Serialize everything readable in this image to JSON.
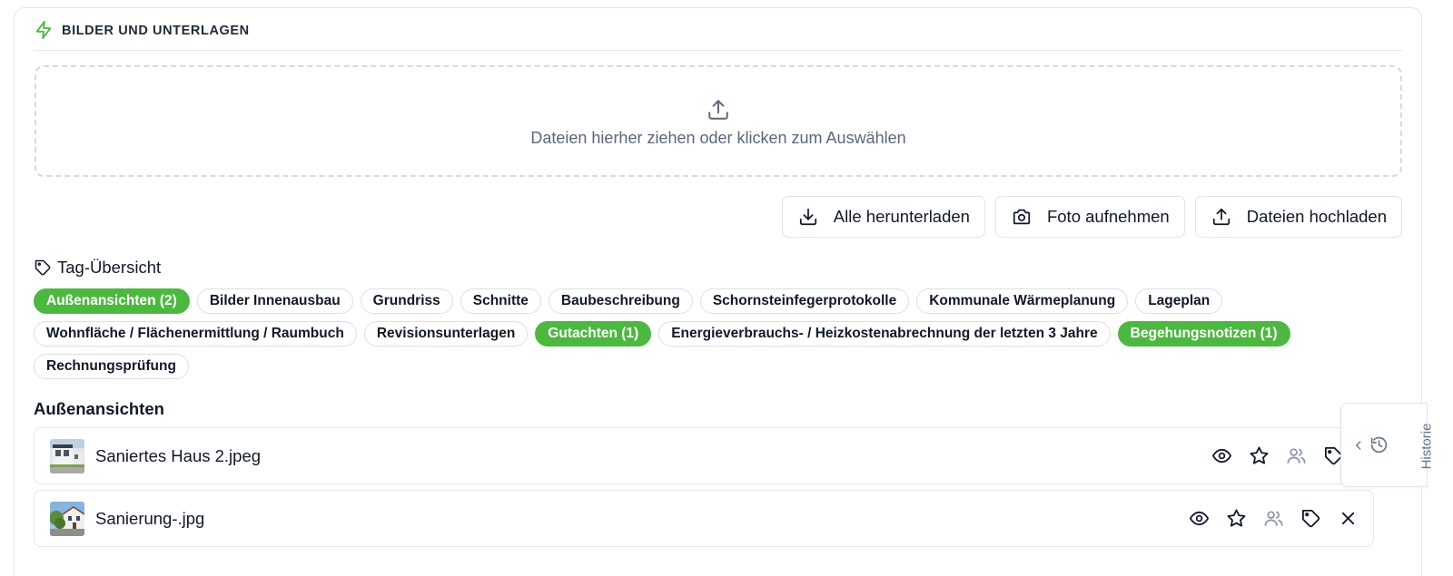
{
  "header": {
    "title": "BILDER UND UNTERLAGEN",
    "icon": "bolt-icon",
    "accent": "#4db840"
  },
  "dropzone": {
    "text": "Dateien hierher ziehen oder klicken zum Auswählen",
    "icon": "upload-icon"
  },
  "actions": {
    "download_all": "Alle herunterladen",
    "take_photo": "Foto aufnehmen",
    "upload_files": "Dateien hochladen"
  },
  "tags": {
    "title": "Tag-Übersicht",
    "items": [
      {
        "label": "Außenansichten (2)",
        "active": true
      },
      {
        "label": "Bilder Innenausbau",
        "active": false
      },
      {
        "label": "Grundriss",
        "active": false
      },
      {
        "label": "Schnitte",
        "active": false
      },
      {
        "label": "Baubeschreibung",
        "active": false
      },
      {
        "label": "Schornsteinfegerprotokolle",
        "active": false
      },
      {
        "label": "Kommunale Wärmeplanung",
        "active": false
      },
      {
        "label": "Lageplan",
        "active": false
      },
      {
        "label": "Wohnfläche / Flächenermittlung / Raumbuch",
        "active": false
      },
      {
        "label": "Revisionsunterlagen",
        "active": false
      },
      {
        "label": "Gutachten (1)",
        "active": true
      },
      {
        "label": "Energieverbrauchs- / Heizkostenabrechnung der letzten 3 Jahre",
        "active": false
      },
      {
        "label": "Begehungsnotizen (1)",
        "active": true
      },
      {
        "label": "Rechnungsprüfung",
        "active": false
      }
    ]
  },
  "section": {
    "title": "Außenansichten"
  },
  "files": [
    {
      "name": "Saniertes Haus 2.jpeg"
    },
    {
      "name": "Sanierung-.jpg"
    }
  ],
  "history": {
    "label": "Historie"
  }
}
